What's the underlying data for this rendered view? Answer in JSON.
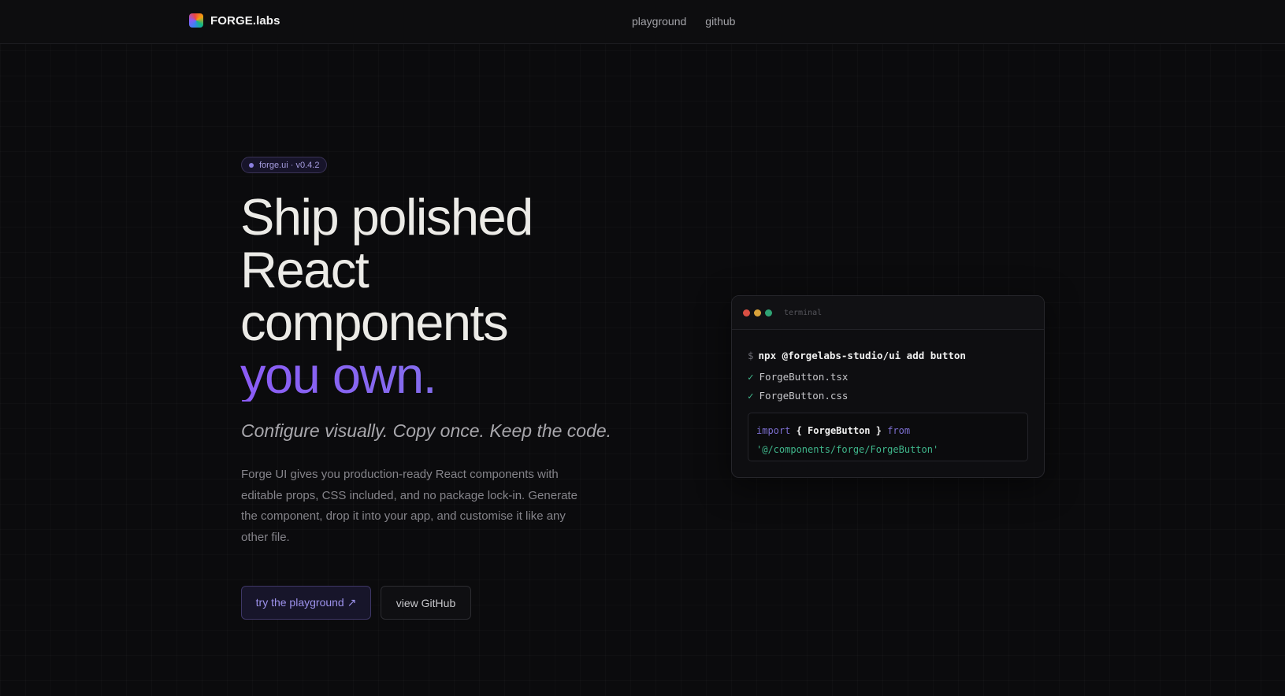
{
  "nav": {
    "brand": "FORGE.labs",
    "links": [
      "playground",
      "github"
    ]
  },
  "hero": {
    "badge": "forge.ui · v0.4.2",
    "headline_lines": [
      "Ship polished",
      "React",
      "components"
    ],
    "headline_accent": "you own.",
    "tagline": "Configure visually. Copy once. Keep the code.",
    "description": "Forge UI gives you production-ready React components with editable props, CSS included, and no package lock-in. Generate the component, drop it into your app, and customise it like any other file.",
    "primary_button": "try the playground ↗",
    "secondary_button": "view GitHub"
  },
  "terminal": {
    "title": "terminal",
    "prompt": "$",
    "command": "npx @forgelabs-studio/ui add button",
    "check": "✓",
    "outputs": [
      "ForgeButton.tsx",
      "ForgeButton.css"
    ],
    "code": {
      "import_kw": "import",
      "ident": "{ ForgeButton }",
      "from_kw": "from",
      "path": "'@/components/forge/ForgeButton'"
    }
  }
}
